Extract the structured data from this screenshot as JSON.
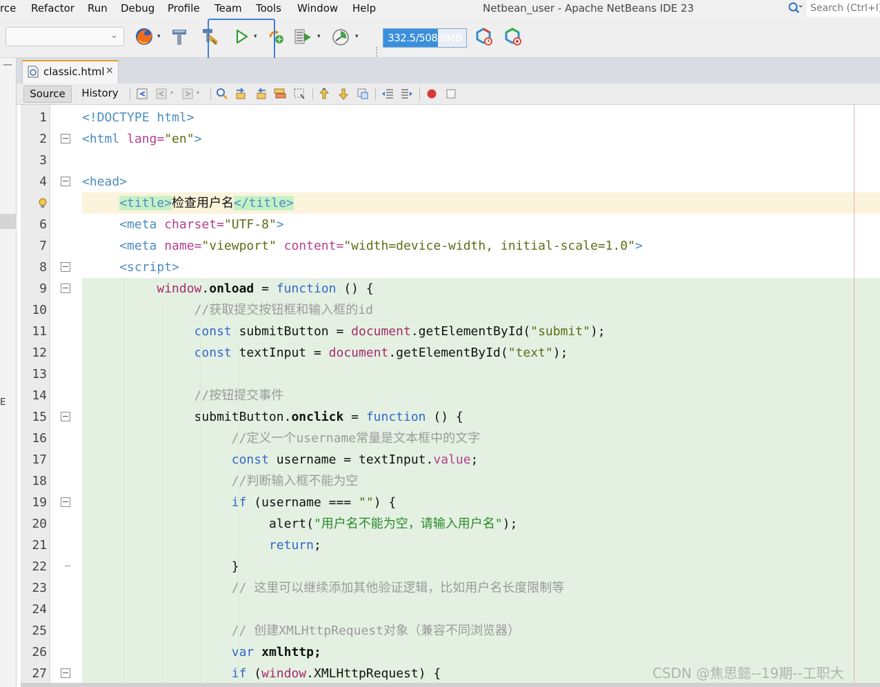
{
  "menu": {
    "items": [
      {
        "label": "rce",
        "name": "menu-source"
      },
      {
        "label": "Refactor",
        "name": "menu-refactor"
      },
      {
        "label": "Run",
        "name": "menu-run"
      },
      {
        "label": "Debug",
        "name": "menu-debug"
      },
      {
        "label": "Profile",
        "name": "menu-profile"
      },
      {
        "label": "Team",
        "name": "menu-team"
      },
      {
        "label": "Tools",
        "name": "menu-tools"
      },
      {
        "label": "Window",
        "name": "menu-window"
      },
      {
        "label": "Help",
        "name": "menu-help"
      }
    ]
  },
  "window": {
    "title": "Netbean_user - Apache NetBeans IDE 23"
  },
  "search": {
    "placeholder": "Search (Ctrl+I)"
  },
  "toolbar": {
    "memory": {
      "used_mb": 332.5,
      "total_mb": 508.0,
      "label": "332.5/508.0MB",
      "fill_color": "#3a8fdc"
    }
  },
  "editor_tab": {
    "file_name": "classic.html"
  },
  "editor_toolbar": {
    "source_label": "Source",
    "history_label": "History"
  },
  "colors": {
    "accent_tab": "#e89b2c",
    "highlight_green": "#e4f1e2",
    "highlight_yellow": "#fbf3dc",
    "selection_blue": "#3d7bd9"
  },
  "code": {
    "lines": [
      {
        "n": "1",
        "bg": "none",
        "fold": "",
        "indent": 0,
        "tokens": [
          {
            "t": "<!DOCTYPE html>",
            "c": "t-tag"
          }
        ]
      },
      {
        "n": "2",
        "bg": "none",
        "fold": "open",
        "indent": 0,
        "tokens": [
          {
            "t": "<html",
            "c": "t-tag"
          },
          {
            "t": " lang=",
            "c": "t-attr"
          },
          {
            "t": "\"en\"",
            "c": "t-str"
          },
          {
            "t": ">",
            "c": "t-tag"
          }
        ]
      },
      {
        "n": "3",
        "bg": "none",
        "fold": "",
        "indent": 0,
        "tokens": []
      },
      {
        "n": "4",
        "bg": "none",
        "fold": "open",
        "indent": 0,
        "tokens": [
          {
            "t": "<head>",
            "c": "t-tag"
          }
        ]
      },
      {
        "n": "",
        "bg": "yellow",
        "fold": "",
        "bulb": true,
        "indent": 1,
        "tokens": [
          {
            "t": "<title>",
            "c": "t-tag t-title-hl"
          },
          {
            "t": "检查用户名",
            "c": "t-plain"
          },
          {
            "t": "</title>",
            "c": "t-tag t-title-hl"
          }
        ]
      },
      {
        "n": "6",
        "bg": "none",
        "fold": "",
        "indent": 1,
        "tokens": [
          {
            "t": "<meta",
            "c": "t-tag"
          },
          {
            "t": " charset=",
            "c": "t-attr"
          },
          {
            "t": "\"UTF-8\"",
            "c": "t-str"
          },
          {
            "t": ">",
            "c": "t-tag"
          }
        ]
      },
      {
        "n": "7",
        "bg": "none",
        "fold": "",
        "indent": 1,
        "tokens": [
          {
            "t": "<meta",
            "c": "t-tag"
          },
          {
            "t": " name=",
            "c": "t-attr"
          },
          {
            "t": "\"viewport\"",
            "c": "t-str"
          },
          {
            "t": " content=",
            "c": "t-attr"
          },
          {
            "t": "\"width=device-width, initial-scale=1.0\"",
            "c": "t-str"
          },
          {
            "t": ">",
            "c": "t-tag"
          }
        ]
      },
      {
        "n": "8",
        "bg": "none",
        "fold": "open",
        "indent": 1,
        "tokens": [
          {
            "t": "<script>",
            "c": "t-tag"
          }
        ]
      },
      {
        "n": "9",
        "bg": "green",
        "fold": "open",
        "indent": 2,
        "tokens": [
          {
            "t": "window",
            "c": "t-doc"
          },
          {
            "t": ".",
            "c": "t-plain"
          },
          {
            "t": "onload",
            "c": "t-bold"
          },
          {
            "t": " = ",
            "c": "t-plain"
          },
          {
            "t": "function",
            "c": "t-kw"
          },
          {
            "t": " () {",
            "c": "t-plain"
          }
        ]
      },
      {
        "n": "10",
        "bg": "green",
        "fold": "",
        "indent": 3,
        "tokens": [
          {
            "t": "//获取提交按钮框和输入框的id",
            "c": "t-cmt"
          }
        ]
      },
      {
        "n": "11",
        "bg": "green",
        "fold": "",
        "indent": 3,
        "tokens": [
          {
            "t": "const",
            "c": "t-kw"
          },
          {
            "t": " submitButton = ",
            "c": "t-plain"
          },
          {
            "t": "document",
            "c": "t-doc"
          },
          {
            "t": ".getElementById(",
            "c": "t-plain"
          },
          {
            "t": "\"submit\"",
            "c": "t-str"
          },
          {
            "t": ");",
            "c": "t-plain"
          }
        ]
      },
      {
        "n": "12",
        "bg": "green",
        "fold": "",
        "indent": 3,
        "tokens": [
          {
            "t": "const",
            "c": "t-kw"
          },
          {
            "t": " textInput = ",
            "c": "t-plain"
          },
          {
            "t": "document",
            "c": "t-doc"
          },
          {
            "t": ".getElementById(",
            "c": "t-plain"
          },
          {
            "t": "\"text\"",
            "c": "t-str"
          },
          {
            "t": ");",
            "c": "t-plain"
          }
        ]
      },
      {
        "n": "13",
        "bg": "green",
        "fold": "",
        "indent": 0,
        "tokens": []
      },
      {
        "n": "14",
        "bg": "green",
        "fold": "",
        "indent": 3,
        "tokens": [
          {
            "t": "//按钮提交事件",
            "c": "t-cmt"
          }
        ]
      },
      {
        "n": "15",
        "bg": "green",
        "fold": "open",
        "indent": 3,
        "tokens": [
          {
            "t": "submitButton.",
            "c": "t-plain"
          },
          {
            "t": "onclick",
            "c": "t-bold"
          },
          {
            "t": " = ",
            "c": "t-plain"
          },
          {
            "t": "function",
            "c": "t-kw"
          },
          {
            "t": " () {",
            "c": "t-plain"
          }
        ]
      },
      {
        "n": "16",
        "bg": "green",
        "fold": "",
        "indent": 4,
        "tokens": [
          {
            "t": "//定义一个username常量是文本框中的文字",
            "c": "t-cmt"
          }
        ]
      },
      {
        "n": "17",
        "bg": "green",
        "fold": "",
        "indent": 4,
        "tokens": [
          {
            "t": "const",
            "c": "t-kw"
          },
          {
            "t": " username = textInput.",
            "c": "t-plain"
          },
          {
            "t": "value",
            "c": "t-attr"
          },
          {
            "t": ";",
            "c": "t-plain"
          }
        ]
      },
      {
        "n": "18",
        "bg": "green",
        "fold": "",
        "indent": 4,
        "tokens": [
          {
            "t": "//判断输入框不能为空",
            "c": "t-cmt"
          }
        ]
      },
      {
        "n": "19",
        "bg": "green",
        "fold": "open",
        "indent": 4,
        "tokens": [
          {
            "t": "if",
            "c": "t-kw"
          },
          {
            "t": " (username === ",
            "c": "t-plain"
          },
          {
            "t": "\"\"",
            "c": "t-str"
          },
          {
            "t": ") {",
            "c": "t-plain"
          }
        ]
      },
      {
        "n": "20",
        "bg": "green",
        "fold": "",
        "indent": 5,
        "tokens": [
          {
            "t": "alert(",
            "c": "t-plain"
          },
          {
            "t": "\"用户名不能为空，请输入用户名\"",
            "c": "t-str2"
          },
          {
            "t": ");",
            "c": "t-plain"
          }
        ]
      },
      {
        "n": "21",
        "bg": "green",
        "fold": "",
        "indent": 5,
        "tokens": [
          {
            "t": "return",
            "c": "t-kw"
          },
          {
            "t": ";",
            "c": "t-plain"
          }
        ]
      },
      {
        "n": "22",
        "bg": "green",
        "fold": "end",
        "indent": 4,
        "tokens": [
          {
            "t": "}",
            "c": "t-plain"
          }
        ]
      },
      {
        "n": "23",
        "bg": "green",
        "fold": "",
        "indent": 4,
        "tokens": [
          {
            "t": "// 这里可以继续添加其他验证逻辑，比如用户名长度限制等",
            "c": "t-cmt"
          }
        ]
      },
      {
        "n": "24",
        "bg": "green",
        "fold": "",
        "indent": 0,
        "tokens": []
      },
      {
        "n": "25",
        "bg": "green",
        "fold": "",
        "indent": 4,
        "tokens": [
          {
            "t": "// 创建XMLHttpRequest对象（兼容不同浏览器）",
            "c": "t-cmt"
          }
        ]
      },
      {
        "n": "26",
        "bg": "green",
        "fold": "",
        "indent": 4,
        "tokens": [
          {
            "t": "var",
            "c": "t-kw"
          },
          {
            "t": " ",
            "c": "t-plain"
          },
          {
            "t": "xmlhttp;",
            "c": "t-bold"
          }
        ]
      },
      {
        "n": "27",
        "bg": "green",
        "fold": "open",
        "indent": 4,
        "tokens": [
          {
            "t": "if",
            "c": "t-kw"
          },
          {
            "t": " (",
            "c": "t-plain"
          },
          {
            "t": "window",
            "c": "t-doc"
          },
          {
            "t": ".XMLHttpRequest) {",
            "c": "t-plain"
          }
        ]
      }
    ]
  },
  "left_strip": {
    "letter": "E"
  },
  "watermark": {
    "text": "CSDN @焦思懿--19期--工职大"
  }
}
